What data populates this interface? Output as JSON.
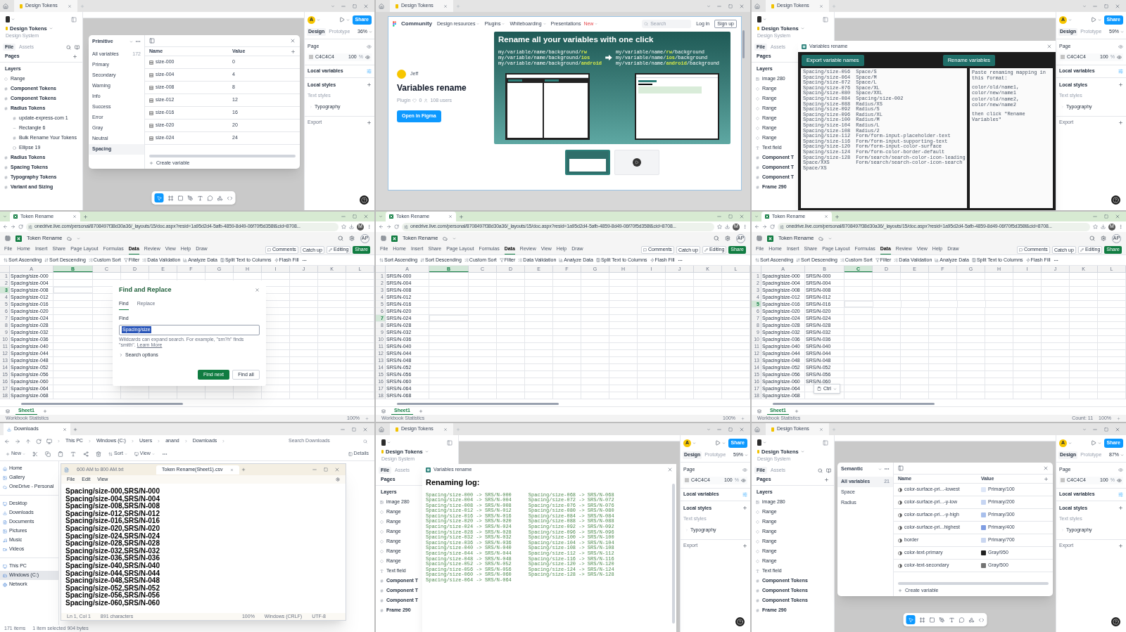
{
  "panels": [
    {
      "kind": "figma",
      "figma": {
        "tab": "Design Tokens",
        "file_name": "Design Tokens",
        "project": "Design System",
        "sidebar_tabs": [
          {
            "label": "File",
            "selected": true
          },
          {
            "label": "Assets",
            "selected": false
          }
        ],
        "pages": "Pages",
        "layers_heading": "Layers",
        "layers": [
          {
            "kind": "range",
            "name": "Range"
          },
          {
            "kind": "frame",
            "name": "Component Tokens"
          },
          {
            "kind": "frame",
            "name": "Component Tokens"
          },
          {
            "kind": "frame",
            "name": "Radius Tokens",
            "children": [
              {
                "kind": "frame",
                "name": "update-express-com 1"
              },
              {
                "kind": "line",
                "name": "Rectangle 6"
              },
              {
                "kind": "frame",
                "name": "Bulk Rename Your Tokens"
              },
              {
                "kind": "ellipse",
                "name": "Ellipse 19"
              }
            ]
          },
          {
            "kind": "frame",
            "name": "Radius Tokens"
          },
          {
            "kind": "frame",
            "name": "Spacing Tokens"
          },
          {
            "kind": "frame",
            "name": "Typography Tokens"
          },
          {
            "kind": "frame",
            "name": "Variant and Sizing"
          }
        ],
        "avatar": "A",
        "share": "Share",
        "mode_tabs": [
          {
            "label": "Design",
            "selected": true
          },
          {
            "label": "Prototype",
            "selected": false
          }
        ],
        "zoom": "36%",
        "page_heading": "Page",
        "page_color": "C4C4C4",
        "page_opacity": "100",
        "percent": "%",
        "local_variables": "Local variables",
        "local_styles": "Local styles",
        "text_styles": "Text styles",
        "typography": "Typography",
        "export": "Export",
        "toolbar": true
      },
      "overlay": {
        "kind": "variables",
        "collection": "Primitive",
        "groups": [
          {
            "label": "All variables",
            "count": "172",
            "selected": false
          },
          {
            "label": "Primary",
            "selected": false
          },
          {
            "label": "Secondary",
            "selected": false
          },
          {
            "label": "Warning",
            "selected": false
          },
          {
            "label": "Info",
            "selected": false
          },
          {
            "label": "Success",
            "selected": false
          },
          {
            "label": "Error",
            "selected": false
          },
          {
            "label": "Gray",
            "selected": false
          },
          {
            "label": "Neutral",
            "selected": false
          },
          {
            "label": "Spacing",
            "selected": true
          }
        ],
        "columns": [
          "Name",
          "Value"
        ],
        "rows": [
          {
            "name": "size-000",
            "value": "0"
          },
          {
            "name": "size-004",
            "value": "4"
          },
          {
            "name": "size-008",
            "value": "8"
          },
          {
            "name": "size-012",
            "value": "12"
          },
          {
            "name": "size-016",
            "value": "16"
          },
          {
            "name": "size-020",
            "value": "20"
          },
          {
            "name": "size-024",
            "value": "24"
          }
        ],
        "create": "Create variable"
      }
    },
    {
      "kind": "community",
      "tab": "Design Tokens",
      "nav": {
        "brand": "Community",
        "menus": [
          "Design resources",
          "Plugins",
          "Whiteboarding",
          "Presentations"
        ],
        "badge": "New",
        "search": "Search",
        "login": "Log in",
        "signup": "Sign up"
      },
      "author": "Jeff",
      "title": "Variables rename",
      "meta": [
        "Plugin",
        "0",
        "108 users"
      ],
      "open": "Open in Figma",
      "banner": {
        "heading": "Rename all your variables with one click",
        "before": [
          {
            "base": "my/variable/name/background/",
            "tag": "rw"
          },
          {
            "base": "my/variable/name/background/",
            "tag": "ios"
          },
          {
            "base": "my/variable/name/background/",
            "tag": "android"
          }
        ],
        "after": [
          {
            "base": "my/variable/name/",
            "tag": "rw",
            "rest": "/background"
          },
          {
            "base": "my/variable/name/",
            "tag": "ios",
            "rest": "/background"
          },
          {
            "base": "my/variable/name/",
            "tag": "android",
            "rest": "/background"
          }
        ]
      },
      "thumbnails": [
        {
          "kind": "image",
          "selected": true
        },
        {
          "kind": "video",
          "selected": false
        }
      ]
    },
    {
      "kind": "figma",
      "figma": {
        "tab": "Design Tokens",
        "file_name": "Design Tokens",
        "project": "Design System",
        "sidebar_tabs": [
          {
            "label": "File",
            "selected": true
          },
          {
            "label": "Assets",
            "selected": false
          }
        ],
        "pages": "Pages",
        "layers_heading": "Layers",
        "layers": [
          {
            "kind": "image",
            "name": "image 280"
          },
          {
            "kind": "range",
            "name": "Range"
          },
          {
            "kind": "range",
            "name": "Range"
          },
          {
            "kind": "range",
            "name": "Range"
          },
          {
            "kind": "range",
            "name": "Range"
          },
          {
            "kind": "range",
            "name": "Range"
          },
          {
            "kind": "range",
            "name": "Range"
          },
          {
            "kind": "text",
            "name": "Text field"
          },
          {
            "kind": "frame",
            "name": "Component T"
          },
          {
            "kind": "frame",
            "name": "Component T"
          },
          {
            "kind": "frame",
            "name": "Component T"
          },
          {
            "kind": "frame",
            "name": "Frame 290"
          }
        ],
        "avatar": "A",
        "share": "Share",
        "mode_tabs": [
          {
            "label": "Design",
            "selected": true
          },
          {
            "label": "Prototype",
            "selected": false
          }
        ],
        "zoom": "59%",
        "page_heading": "Page",
        "page_color": "C4C4C4",
        "page_opacity": "100",
        "percent": "%",
        "local_variables": "Local variables",
        "local_styles": "Local styles",
        "text_styles": "Text styles",
        "typography": "Typography",
        "export": "Export"
      },
      "overlay": {
        "kind": "plugin_export",
        "title": "Variables rename",
        "buttons": [
          "Export variable names",
          "Rename variables"
        ],
        "names": [
          "Spacing/size-056",
          "Spacing/size-064",
          "Spacing/size-072",
          "Spacing/size-076",
          "Spacing/size-080",
          "Spacing/size-084",
          "Spacing/size-088",
          "Spacing/size-092",
          "Spacing/size-096",
          "Spacing/size-100",
          "Spacing/size-104",
          "Spacing/size-108",
          "Spacing/size-112",
          "Spacing/size-116",
          "Spacing/size-120",
          "Spacing/size-124",
          "Spacing/size-128",
          "Space/XXS",
          "Space/XS",
          "Space/S",
          "Space/M",
          "Space/L",
          "Space/XL",
          "Space/XXL",
          "Spacing/size-002",
          "Radius/XS",
          "Radius/S",
          "Radius/XL",
          "Radius/M",
          "Radius/L",
          "Radius/2",
          "Form/form-input-placeholder-text",
          "Form/form-input-supporting-text",
          "Form/form-input-color-surface",
          "Form/form-color-border-default",
          "Form/search/search-color-icon-leading",
          "Form/search/search-color-icon-search"
        ],
        "instructions": [
          "Paste renaming mapping in this format:",
          "color/old/name1, color/new/name1",
          "color/old/name2, color/new/name2",
          "then click \"Rename Variables\""
        ]
      }
    },
    {
      "kind": "excel",
      "excel": {
        "tab": "Token Rename",
        "url": "onedrive.live.com/personal/8708497f38d30a36/_layouts/15/doc.aspx?resid=1a95d2d4-5afb-4859-8d49-06f70f5d358f&cid=8708...",
        "profile": "M",
        "title": "Token Rename",
        "user": "AP",
        "menus": [
          {
            "label": "File",
            "selected": false
          },
          {
            "label": "Home",
            "selected": false
          },
          {
            "label": "Insert",
            "selected": false
          },
          {
            "label": "Share",
            "selected": false
          },
          {
            "label": "Page Layout",
            "selected": false
          },
          {
            "label": "Formulas",
            "selected": false
          },
          {
            "label": "Data",
            "selected": true
          },
          {
            "label": "Review",
            "selected": false
          },
          {
            "label": "View",
            "selected": false
          },
          {
            "label": "Help",
            "selected": false
          },
          {
            "label": "Draw",
            "selected": false
          }
        ],
        "actions": [
          "Comments",
          "Catch up",
          "Editing",
          "Share"
        ],
        "ribbon": [
          "Sort Ascending",
          "Sort Descending",
          "Custom Sort",
          "Filter",
          "Data Validation",
          "Analyze Data",
          "Split Text to Columns",
          "Flash Fill"
        ],
        "columns": [
          {
            "label": "A",
            "selected": false
          },
          {
            "label": "B",
            "selected": true
          },
          {
            "label": "C",
            "selected": false
          },
          {
            "label": "D",
            "selected": false
          },
          {
            "label": "E",
            "selected": false
          },
          {
            "label": "F",
            "selected": false
          },
          {
            "label": "G",
            "selected": false
          },
          {
            "label": "H",
            "selected": false
          },
          {
            "label": "I",
            "selected": false
          },
          {
            "label": "J",
            "selected": false
          },
          {
            "label": "K",
            "selected": false
          },
          {
            "label": "L",
            "selected": false
          }
        ],
        "rows": [
          {
            "n": "1",
            "cells": [
              "Spacing/size-000"
            ],
            "selected": false
          },
          {
            "n": "2",
            "cells": [
              "Spacing/size-004"
            ],
            "selected": false
          },
          {
            "n": "3",
            "cells": [
              "Spacing/size-008"
            ],
            "selected": true
          },
          {
            "n": "4",
            "cells": [
              "Spacing/size-012"
            ],
            "selected": false
          },
          {
            "n": "5",
            "cells": [
              "Spacing/size-016"
            ],
            "selected": false
          },
          {
            "n": "6",
            "cells": [
              "Spacing/size-020"
            ],
            "selected": false
          },
          {
            "n": "7",
            "cells": [
              "Spacing/size-024"
            ],
            "selected": false
          },
          {
            "n": "8",
            "cells": [
              "Spacing/size-028"
            ],
            "selected": false
          },
          {
            "n": "9",
            "cells": [
              "Spacing/size-032"
            ],
            "selected": false
          },
          {
            "n": "10",
            "cells": [
              "Spacing/size-036"
            ],
            "selected": false
          },
          {
            "n": "11",
            "cells": [
              "Spacing/size-040"
            ],
            "selected": false
          },
          {
            "n": "12",
            "cells": [
              "Spacing/size-044"
            ],
            "selected": false
          },
          {
            "n": "13",
            "cells": [
              "Spacing/size-048"
            ],
            "selected": false
          },
          {
            "n": "14",
            "cells": [
              "Spacing/size-052"
            ],
            "selected": false
          },
          {
            "n": "15",
            "cells": [
              "Spacing/size-056"
            ],
            "selected": false
          },
          {
            "n": "16",
            "cells": [
              "Spacing/size-060"
            ],
            "selected": false
          },
          {
            "n": "17",
            "cells": [
              "Spacing/size-064"
            ],
            "selected": false
          },
          {
            "n": "18",
            "cells": [
              "Spacing/size-068"
            ],
            "selected": false
          }
        ],
        "sheet": "Sheet1",
        "status": "Workbook Statistics",
        "zoom": "100%"
      },
      "dialog": {
        "title": "Find and Replace",
        "tabs": [
          {
            "label": "Find",
            "selected": true
          },
          {
            "label": "Replace",
            "selected": false
          }
        ],
        "label": "Find",
        "value": "Spacing/size",
        "hint": "Wildcards can expand search. For example, \"sm?h\" finds \"smith\".",
        "link": "Learn More",
        "options": "Search options",
        "buttons": [
          "Find next",
          "Find all"
        ]
      }
    },
    {
      "kind": "excel",
      "excel": {
        "tab": "Token Rename",
        "url": "onedrive.live.com/personal/8708497f38d30a36/_layouts/15/doc.aspx?resid=1a95d2d4-5afb-4859-8d49-06f70f5d358f&cid=8708...",
        "profile": "M",
        "title": "Token Rename",
        "user": "AP",
        "menus": [
          {
            "label": "File",
            "selected": false
          },
          {
            "label": "Home",
            "selected": false
          },
          {
            "label": "Insert",
            "selected": false
          },
          {
            "label": "Share",
            "selected": false
          },
          {
            "label": "Page Layout",
            "selected": false
          },
          {
            "label": "Formulas",
            "selected": false
          },
          {
            "label": "Data",
            "selected": true
          },
          {
            "label": "Review",
            "selected": false
          },
          {
            "label": "View",
            "selected": false
          },
          {
            "label": "Help",
            "selected": false
          },
          {
            "label": "Draw",
            "selected": false
          }
        ],
        "actions": [
          "Comments",
          "Catch up",
          "Editing",
          "Share"
        ],
        "ribbon": [
          "Sort Ascending",
          "Sort Descending",
          "Custom Sort",
          "Filter",
          "Data Validation",
          "Analyze Data",
          "Split Text to Columns",
          "Flash Fill"
        ],
        "columns": [
          {
            "label": "A",
            "selected": false
          },
          {
            "label": "B",
            "selected": true
          },
          {
            "label": "C",
            "selected": false
          },
          {
            "label": "D",
            "selected": false
          },
          {
            "label": "E",
            "selected": false
          },
          {
            "label": "F",
            "selected": false
          },
          {
            "label": "G",
            "selected": false
          },
          {
            "label": "H",
            "selected": false
          },
          {
            "label": "I",
            "selected": false
          },
          {
            "label": "J",
            "selected": false
          },
          {
            "label": "K",
            "selected": false
          },
          {
            "label": "L",
            "selected": false
          }
        ],
        "rows": [
          {
            "n": "1",
            "cells": [
              "SRS/N-000"
            ],
            "selected": false
          },
          {
            "n": "2",
            "cells": [
              "SRS/N-004"
            ],
            "selected": false
          },
          {
            "n": "3",
            "cells": [
              "SRS/N-008"
            ],
            "selected": false
          },
          {
            "n": "4",
            "cells": [
              "SRS/N-012"
            ],
            "selected": false
          },
          {
            "n": "5",
            "cells": [
              "SRS/N-016"
            ],
            "selected": false
          },
          {
            "n": "6",
            "cells": [
              "SRS/N-020"
            ],
            "selected": false
          },
          {
            "n": "7",
            "cells": [
              "SRS/N-024"
            ],
            "selected": true
          },
          {
            "n": "8",
            "cells": [
              "SRS/N-028"
            ],
            "selected": false
          },
          {
            "n": "9",
            "cells": [
              "SRS/N-032"
            ],
            "selected": false
          },
          {
            "n": "10",
            "cells": [
              "SRS/N-036"
            ],
            "selected": false
          },
          {
            "n": "11",
            "cells": [
              "SRS/N-040"
            ],
            "selected": false
          },
          {
            "n": "12",
            "cells": [
              "SRS/N-044"
            ],
            "selected": false
          },
          {
            "n": "13",
            "cells": [
              "SRS/N-048"
            ],
            "selected": false
          },
          {
            "n": "14",
            "cells": [
              "SRS/N-052"
            ],
            "selected": false
          },
          {
            "n": "15",
            "cells": [
              "SRS/N-056"
            ],
            "selected": false
          },
          {
            "n": "16",
            "cells": [
              "SRS/N-060"
            ],
            "selected": false
          },
          {
            "n": "17",
            "cells": [
              "SRS/N-064"
            ],
            "selected": false
          },
          {
            "n": "18",
            "cells": [
              "SRS/N-068"
            ],
            "selected": false
          }
        ],
        "sheet": "Sheet1",
        "status": "Workbook Statistics",
        "zoom": "100%"
      }
    },
    {
      "kind": "excel",
      "excel": {
        "tab": "Token Rename",
        "url": "onedrive.live.com/personal/8708497f38d30a36/_layouts/15/doc.aspx?resid=1a95d2d4-5afb-4859-8d49-06f70f5d358f&cid=8708...",
        "profile": "M",
        "title": "Token Rename",
        "user": "AP",
        "menus": [
          {
            "label": "File",
            "selected": false
          },
          {
            "label": "Home",
            "selected": false
          },
          {
            "label": "Insert",
            "selected": false
          },
          {
            "label": "Share",
            "selected": false
          },
          {
            "label": "Page Layout",
            "selected": false
          },
          {
            "label": "Formulas",
            "selected": false
          },
          {
            "label": "Data",
            "selected": true
          },
          {
            "label": "Review",
            "selected": false
          },
          {
            "label": "View",
            "selected": false
          },
          {
            "label": "Help",
            "selected": false
          },
          {
            "label": "Draw",
            "selected": false
          }
        ],
        "actions": [
          "Comments",
          "Catch up",
          "Editing",
          "Share"
        ],
        "ribbon": [
          "Sort Ascending",
          "Sort Descending",
          "Custom Sort",
          "Filter",
          "Data Validation",
          "Analyze Data",
          "Split Text to Columns",
          "Flash Fill"
        ],
        "columns": [
          {
            "label": "A",
            "selected": false
          },
          {
            "label": "B",
            "selected": false
          },
          {
            "label": "C",
            "selected": true
          },
          {
            "label": "D",
            "selected": false
          },
          {
            "label": "E",
            "selected": false
          },
          {
            "label": "F",
            "selected": false
          },
          {
            "label": "G",
            "selected": false
          },
          {
            "label": "H",
            "selected": false
          },
          {
            "label": "I",
            "selected": false
          },
          {
            "label": "J",
            "selected": false
          },
          {
            "label": "K",
            "selected": false
          },
          {
            "label": "L",
            "selected": false
          }
        ],
        "rows": [
          {
            "n": "1",
            "cells": [
              "Spacing/size-000",
              "SRS/N-000"
            ],
            "selected": false
          },
          {
            "n": "2",
            "cells": [
              "Spacing/size-004",
              "SRS/N-004"
            ],
            "selected": false
          },
          {
            "n": "3",
            "cells": [
              "Spacing/size-008",
              "SRS/N-008"
            ],
            "selected": false
          },
          {
            "n": "4",
            "cells": [
              "Spacing/size-012",
              "SRS/N-012"
            ],
            "selected": false
          },
          {
            "n": "5",
            "cells": [
              "Spacing/size-016",
              "SRS/N-016"
            ],
            "selected": true
          },
          {
            "n": "6",
            "cells": [
              "Spacing/size-020",
              "SRS/N-020"
            ],
            "selected": false
          },
          {
            "n": "7",
            "cells": [
              "Spacing/size-024",
              "SRS/N-024"
            ],
            "selected": false
          },
          {
            "n": "8",
            "cells": [
              "Spacing/size-028",
              "SRS/N-028"
            ],
            "selected": false
          },
          {
            "n": "9",
            "cells": [
              "Spacing/size-032",
              "SRS/N-032"
            ],
            "selected": false
          },
          {
            "n": "10",
            "cells": [
              "Spacing/size-036",
              "SRS/N-036"
            ],
            "selected": false
          },
          {
            "n": "11",
            "cells": [
              "Spacing/size-040",
              "SRS/N-040"
            ],
            "selected": false
          },
          {
            "n": "12",
            "cells": [
              "Spacing/size-044",
              "SRS/N-044"
            ],
            "selected": false
          },
          {
            "n": "13",
            "cells": [
              "Spacing/size-048",
              "SRS/N-048"
            ],
            "selected": false
          },
          {
            "n": "14",
            "cells": [
              "Spacing/size-052",
              "SRS/N-052"
            ],
            "selected": false
          },
          {
            "n": "15",
            "cells": [
              "Spacing/size-056",
              "SRS/N-056"
            ],
            "selected": false
          },
          {
            "n": "16",
            "cells": [
              "Spacing/size-060",
              "SRS/N-060"
            ],
            "selected": false
          },
          {
            "n": "17",
            "cells": [
              "Spacing/size-064"
            ],
            "selected": false
          },
          {
            "n": "18",
            "cells": [
              "Spacing/size-068"
            ],
            "selected": false
          }
        ],
        "sheet": "Sheet1",
        "status": "Workbook Statistics",
        "count": "Count: 11",
        "zoom": "100%"
      },
      "paste": "Ctrl"
    },
    {
      "kind": "explorer",
      "tab": "Downloads",
      "crumbs": [
        "This PC",
        "Windows (C:)",
        "Users",
        "anand",
        "Downloads"
      ],
      "search": "Search Downloads",
      "tools": [
        "New",
        "Sort",
        "View"
      ],
      "details": "Details",
      "nav": [
        [
          {
            "label": "Home",
            "selected": false
          },
          {
            "label": "Gallery",
            "selected": false
          },
          {
            "label": "OneDrive - Personal",
            "selected": false
          }
        ],
        [
          {
            "label": "Desktop",
            "selected": false
          },
          {
            "label": "Downloads",
            "selected": false
          },
          {
            "label": "Documents",
            "selected": false
          },
          {
            "label": "Pictures",
            "selected": false
          },
          {
            "label": "Music",
            "selected": false
          },
          {
            "label": "Videos",
            "selected": false
          }
        ],
        [
          {
            "label": "This PC",
            "selected": false
          },
          {
            "label": "Windows (C:)",
            "selected": true
          },
          {
            "label": "Network",
            "selected": false
          }
        ]
      ],
      "status": [
        "171 items",
        "1 item selected  904 bytes"
      ],
      "notepad": {
        "tabs": [
          {
            "label": "600 AM to 800 AM.txt",
            "selected": false
          },
          {
            "label": "Token Rename(Sheet1).csv",
            "selected": true
          }
        ],
        "menus": [
          "File",
          "Edit",
          "View"
        ],
        "lines": [
          "Spacing/size-000,SRS/N-000",
          "Spacing/size-004,SRS/N-004",
          "Spacing/size-008,SRS/N-008",
          "Spacing/size-012,SRS/N-012",
          "Spacing/size-016,SRS/N-016",
          "Spacing/size-020,SRS/N-020",
          "Spacing/size-024,SRS/N-024",
          "Spacing/size-028,SRS/N-028",
          "Spacing/size-032,SRS/N-032",
          "Spacing/size-036,SRS/N-036",
          "Spacing/size-040,SRS/N-040",
          "Spacing/size-044,SRS/N-044",
          "Spacing/size-048,SRS/N-048",
          "Spacing/size-052,SRS/N-052",
          "Spacing/size-056,SRS/N-056",
          "Spacing/size-060,SRS/N-060"
        ],
        "status": [
          "Ln 1, Col 1",
          "891 characters",
          "100%",
          "Windows (CRLF)",
          "UTF-8"
        ]
      }
    },
    {
      "kind": "figma",
      "figma": {
        "tab": "Design Tokens",
        "file_name": "Design Tokens",
        "project": "Design System",
        "sidebar_tabs": [
          {
            "label": "File",
            "selected": true
          },
          {
            "label": "Assets",
            "selected": false
          }
        ],
        "pages": "Pages",
        "layers_heading": "Layers",
        "layers": [
          {
            "kind": "image",
            "name": "image 280"
          },
          {
            "kind": "range",
            "name": "Range"
          },
          {
            "kind": "range",
            "name": "Range"
          },
          {
            "kind": "range",
            "name": "Range"
          },
          {
            "kind": "range",
            "name": "Range"
          },
          {
            "kind": "range",
            "name": "Range"
          },
          {
            "kind": "range",
            "name": "Range"
          },
          {
            "kind": "text",
            "name": "Text field"
          },
          {
            "kind": "frame",
            "name": "Component T"
          },
          {
            "kind": "frame",
            "name": "Component T"
          },
          {
            "kind": "frame",
            "name": "Component T"
          },
          {
            "kind": "frame",
            "name": "Frame 290"
          }
        ],
        "avatar": "A",
        "share": "Share",
        "mode_tabs": [
          {
            "label": "Design",
            "selected": true
          },
          {
            "label": "Prototype",
            "selected": false
          }
        ],
        "zoom": "59%",
        "page_heading": "Page",
        "page_color": "C4C4C4",
        "page_opacity": "100",
        "percent": "%",
        "local_variables": "Local variables",
        "local_styles": "Local styles",
        "text_styles": "Text styles",
        "typography": "Typography",
        "export": "Export"
      },
      "overlay": {
        "kind": "plugin_log",
        "title": "Variables rename",
        "heading": "Renaming log:",
        "lines": [
          "Spacing/size-000 -> SRS/N-000",
          "Spacing/size-004 -> SRS/N-004",
          "Spacing/size-008 -> SRS/N-008",
          "Spacing/size-012 -> SRS/N-012",
          "Spacing/size-016 -> SRS/N-016",
          "Spacing/size-020 -> SRS/N-020",
          "Spacing/size-024 -> SRS/N-024",
          "Spacing/size-028 -> SRS/N-028",
          "Spacing/size-032 -> SRS/N-032",
          "Spacing/size-036 -> SRS/N-036",
          "Spacing/size-040 -> SRS/N-040",
          "Spacing/size-044 -> SRS/N-044",
          "Spacing/size-048 -> SRS/N-048",
          "Spacing/size-052 -> SRS/N-052",
          "Spacing/size-056 -> SRS/N-056",
          "Spacing/size-060 -> SRS/N-060",
          "Spacing/size-064 -> SRS/N-064",
          "Spacing/size-068 -> SRS/N-068",
          "Spacing/size-072 -> SRS/N-072",
          "Spacing/size-076 -> SRS/N-076",
          "Spacing/size-080 -> SRS/N-080",
          "Spacing/size-084 -> SRS/N-084",
          "Spacing/size-088 -> SRS/N-088",
          "Spacing/size-092 -> SRS/N-092",
          "Spacing/size-096 -> SRS/N-096",
          "Spacing/size-100 -> SRS/N-100",
          "Spacing/size-104 -> SRS/N-104",
          "Spacing/size-108 -> SRS/N-108",
          "Spacing/size-112 -> SRS/N-112",
          "Spacing/size-116 -> SRS/N-116",
          "Spacing/size-120 -> SRS/N-120",
          "Spacing/size-124 -> SRS/N-124",
          "Spacing/size-128 -> SRS/N-128"
        ]
      }
    },
    {
      "kind": "figma",
      "figma": {
        "tab": "Design Tokens",
        "file_name": "Design Tokens",
        "project": "Design System",
        "sidebar_tabs": [
          {
            "label": "File",
            "selected": true
          },
          {
            "label": "Assets",
            "selected": false
          }
        ],
        "pages": "Pages",
        "layers_heading": "Layers",
        "layers": [
          {
            "kind": "image",
            "name": "image 280"
          },
          {
            "kind": "range",
            "name": "Range"
          },
          {
            "kind": "range",
            "name": "Range"
          },
          {
            "kind": "range",
            "name": "Range"
          },
          {
            "kind": "range",
            "name": "Range"
          },
          {
            "kind": "range",
            "name": "Range"
          },
          {
            "kind": "range",
            "name": "Range"
          },
          {
            "kind": "text",
            "name": "Text field"
          },
          {
            "kind": "frame",
            "name": "Component Tokens"
          },
          {
            "kind": "frame",
            "name": "Component Tokens"
          },
          {
            "kind": "frame",
            "name": "Component Tokens"
          },
          {
            "kind": "frame",
            "name": "Frame 290"
          }
        ],
        "avatar": "A",
        "share": "Share",
        "mode_tabs": [
          {
            "label": "Design",
            "selected": true
          },
          {
            "label": "Prototype",
            "selected": false
          }
        ],
        "zoom": "87%",
        "page_heading": "Page",
        "page_color": "C4C4C4",
        "page_opacity": "100",
        "percent": "%",
        "local_variables": "Local variables",
        "local_styles": "Local styles",
        "text_styles": "Text styles",
        "typography": "Typography",
        "export": "Export",
        "toolbar": true
      },
      "overlay": {
        "kind": "variables",
        "collection": "Semantic",
        "groups": [
          {
            "label": "All variables",
            "count": "21",
            "selected": true
          },
          {
            "label": "Space",
            "selected": false
          },
          {
            "label": "Radius",
            "selected": false
          }
        ],
        "columns": [
          "Name",
          "Value"
        ],
        "rows": [
          {
            "name": "color-surface-pri...-lowest",
            "value": "Primary/100",
            "color": "#dde6f7"
          },
          {
            "name": "color-surface-pri...-y-low",
            "value": "Primary/200",
            "color": "#c6d5f2"
          },
          {
            "name": "color-surface-pri...-y-high",
            "value": "Primary/300",
            "color": "#a8bfec"
          },
          {
            "name": "color-surface-pri...highest",
            "value": "Primary/400",
            "color": "#7f9de2"
          },
          {
            "name": "border",
            "value": "Primary/700",
            "color": "#c9d6f0"
          },
          {
            "name": "color-text-primary",
            "value": "Gray/950",
            "color": "#1f1f1f"
          },
          {
            "name": "color-text-secondary",
            "value": "Gray/500",
            "color": "#737373"
          }
        ],
        "create": "Create variable"
      }
    }
  ]
}
